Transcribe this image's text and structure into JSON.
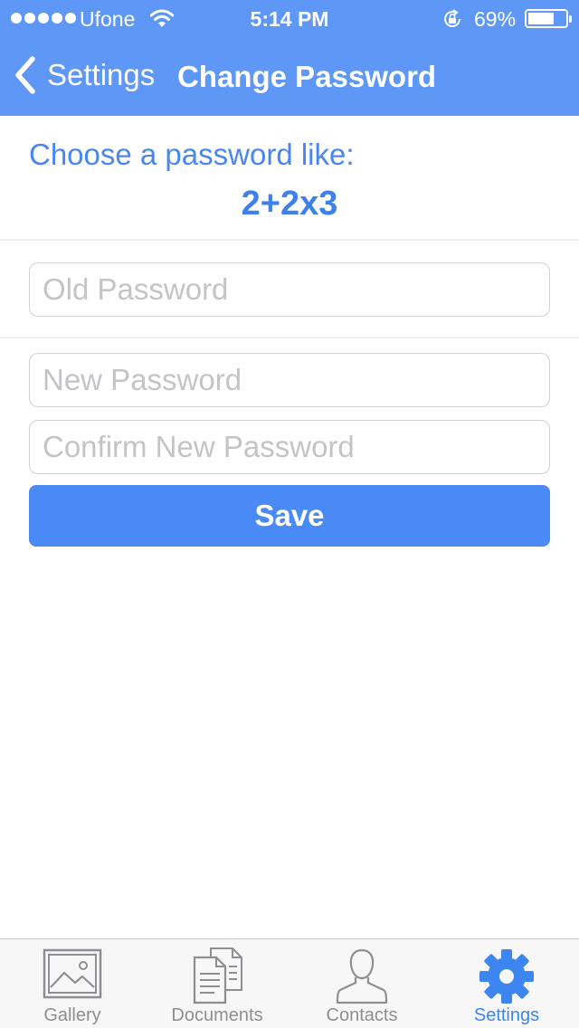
{
  "status_bar": {
    "carrier": "Ufone",
    "time": "5:14 PM",
    "battery_percent": "69%",
    "battery_level": 0.69,
    "signal_bars": 5
  },
  "nav": {
    "back_label": "Settings",
    "title": "Change Password"
  },
  "content": {
    "hint": "Choose a password like:",
    "example": "2+2x3"
  },
  "form": {
    "old_password": {
      "placeholder": "Old Password",
      "value": ""
    },
    "new_password": {
      "placeholder": "New Password",
      "value": ""
    },
    "confirm_password": {
      "placeholder": "Confirm New Password",
      "value": ""
    },
    "save_label": "Save"
  },
  "tabs": [
    {
      "label": "Gallery",
      "icon": "gallery-icon",
      "active": false
    },
    {
      "label": "Documents",
      "icon": "documents-icon",
      "active": false
    },
    {
      "label": "Contacts",
      "icon": "contacts-icon",
      "active": false
    },
    {
      "label": "Settings",
      "icon": "gear-icon",
      "active": true
    }
  ],
  "colors": {
    "nav_background": "#5f97f7",
    "accent": "#4a8af7",
    "tab_inactive": "#8e8e93",
    "tab_active": "#3d85f0"
  }
}
